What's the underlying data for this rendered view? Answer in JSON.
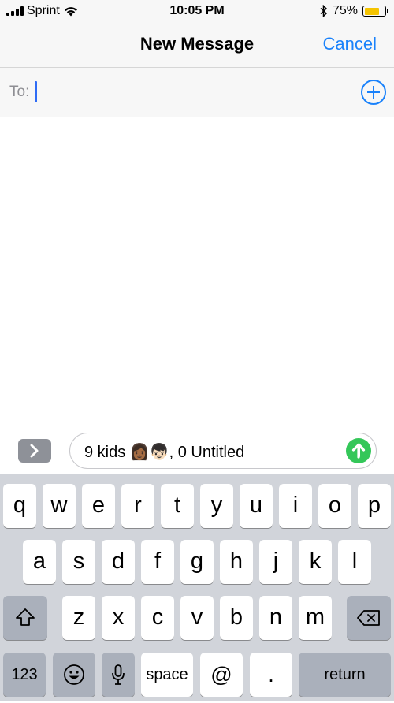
{
  "status_bar": {
    "carrier": "Sprint",
    "time": "10:05 PM",
    "battery_percent": "75%",
    "battery_level": 0.75,
    "battery_color": "#f5c400"
  },
  "nav": {
    "title": "New Message",
    "cancel_label": "Cancel"
  },
  "to_field": {
    "label": "To:"
  },
  "compose": {
    "message_text": "9 kids 👩🏾👦🏻, 0 Untitled",
    "expand_icon": "chevron-right-icon",
    "send_icon": "arrow-up-icon",
    "send_color": "#34c759"
  },
  "keyboard": {
    "row1": [
      "q",
      "w",
      "e",
      "r",
      "t",
      "y",
      "u",
      "i",
      "o",
      "p"
    ],
    "row2": [
      "a",
      "s",
      "d",
      "f",
      "g",
      "h",
      "j",
      "k",
      "l"
    ],
    "row3": [
      "z",
      "x",
      "c",
      "v",
      "b",
      "n",
      "m"
    ],
    "numbers_label": "123",
    "space_label": "space",
    "at_label": "@",
    "period_label": ".",
    "return_label": "return",
    "shift_icon": "shift-arrow-icon",
    "delete_icon": "backspace-icon",
    "emoji_icon": "smiley-icon",
    "mic_icon": "microphone-icon"
  },
  "accent_color": "#1a82fb"
}
